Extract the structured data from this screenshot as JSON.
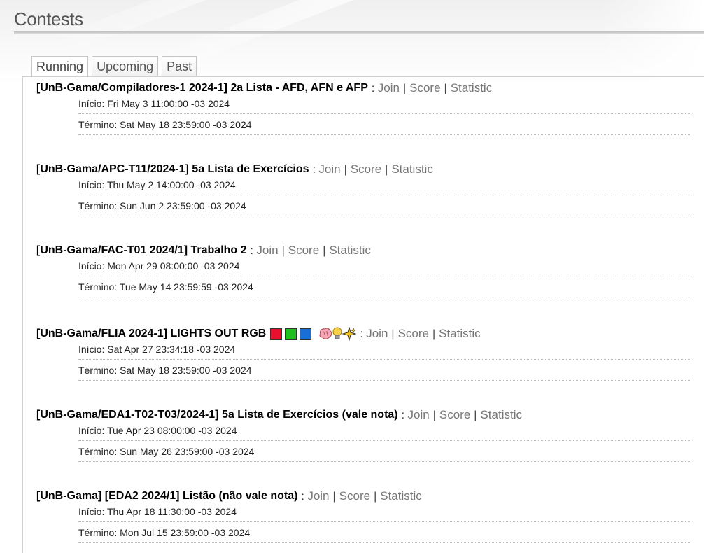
{
  "page": {
    "title": "Contests"
  },
  "tabs": [
    {
      "label": "Running",
      "active": true
    },
    {
      "label": "Upcoming",
      "active": false
    },
    {
      "label": "Past",
      "active": false
    }
  ],
  "link_labels": {
    "join": "Join",
    "score": "Score",
    "statistic": "Statistic"
  },
  "contests": [
    {
      "name": "[UnB-Gama/Compiladores-1 2024-1] 2a Lista - AFD, AFN e AFP",
      "start": "Início: Fri May 3 11:00:00 -03 2024",
      "end": "Término: Sat May 18 23:59:00 -03 2024"
    },
    {
      "name": "[UnB-Gama/APC-T11/2024-1] 5a Lista de Exercícios",
      "start": "Início: Thu May 2 14:00:00 -03 2024",
      "end": "Término: Sun Jun 2 23:59:00 -03 2024"
    },
    {
      "name": "[UnB-Gama/FAC-T01 2024/1] Trabalho 2",
      "start": "Início: Mon Apr 29 08:00:00 -03 2024",
      "end": "Término: Tue May 14 23:59:59 -03 2024"
    },
    {
      "name": "[UnB-Gama/FLIA 2024-1] LIGHTS OUT RGB",
      "start": "Início: Sat Apr 27 23:34:18 -03 2024",
      "end": "Término: Sat May 18 23:59:00 -03 2024",
      "emoji_icons": [
        "red-square-icon",
        "green-square-icon",
        "blue-square-icon",
        "brain-icon",
        "lightbulb-icon",
        "sparkles-icon"
      ],
      "emoji_colors": {
        "red": "#e8112d",
        "green": "#1fbf1f",
        "blue": "#1a6fd6"
      }
    },
    {
      "name": "[UnB-Gama/EDA1-T02-T03/2024-1] 5a Lista de Exercícios (vale nota)",
      "start": "Início: Tue Apr 23 08:00:00 -03 2024",
      "end": "Término: Sun May 26 23:59:00 -03 2024"
    },
    {
      "name": "[UnB-Gama] [EDA2 2024/1] Listão (não vale nota)",
      "start": "Início: Thu Apr 18 11:30:00 -03 2024",
      "end": "Término: Mon Jul 15 23:59:00 -03 2024"
    }
  ]
}
